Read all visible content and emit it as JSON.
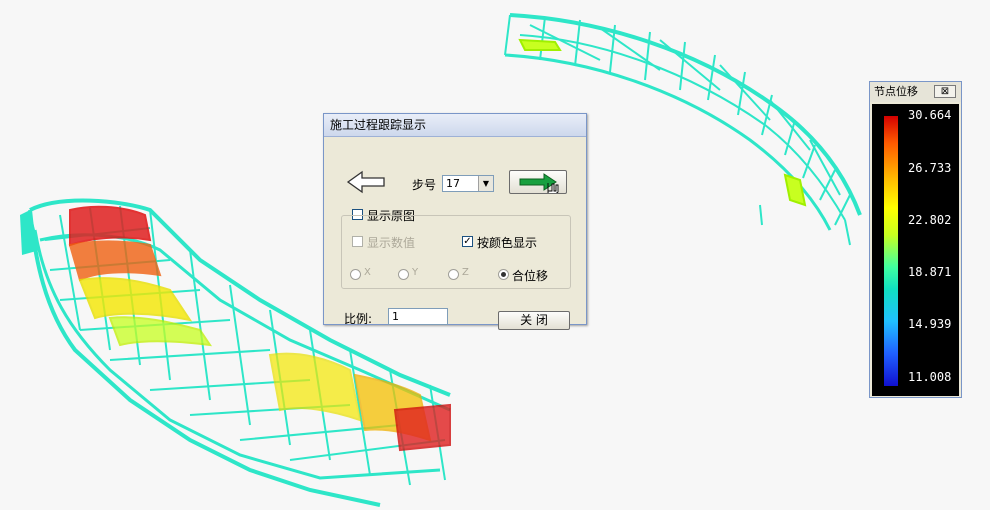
{
  "dialog": {
    "title": "施工过程跟踪显示",
    "step_label": "步号",
    "step_value": "17",
    "show_original_label": "显示原图",
    "show_values_label": "显示数值",
    "color_display_label": "按颜色显示",
    "radio_x": "X",
    "radio_y": "Y",
    "radio_z": "Z",
    "radio_total": "合位移",
    "scale_label": "比例:",
    "scale_value": "1",
    "close_label": "关 闭"
  },
  "legend": {
    "title": "节点位移",
    "close_icon": "⊠",
    "ticks": [
      "30.664",
      "26.733",
      "22.802",
      "18.871",
      "14.939",
      "11.008"
    ],
    "range": [
      11.008,
      30.664
    ]
  },
  "colors": {
    "structure": "#2ee6c8",
    "high": "#e01010",
    "mid": "#f5e800"
  }
}
